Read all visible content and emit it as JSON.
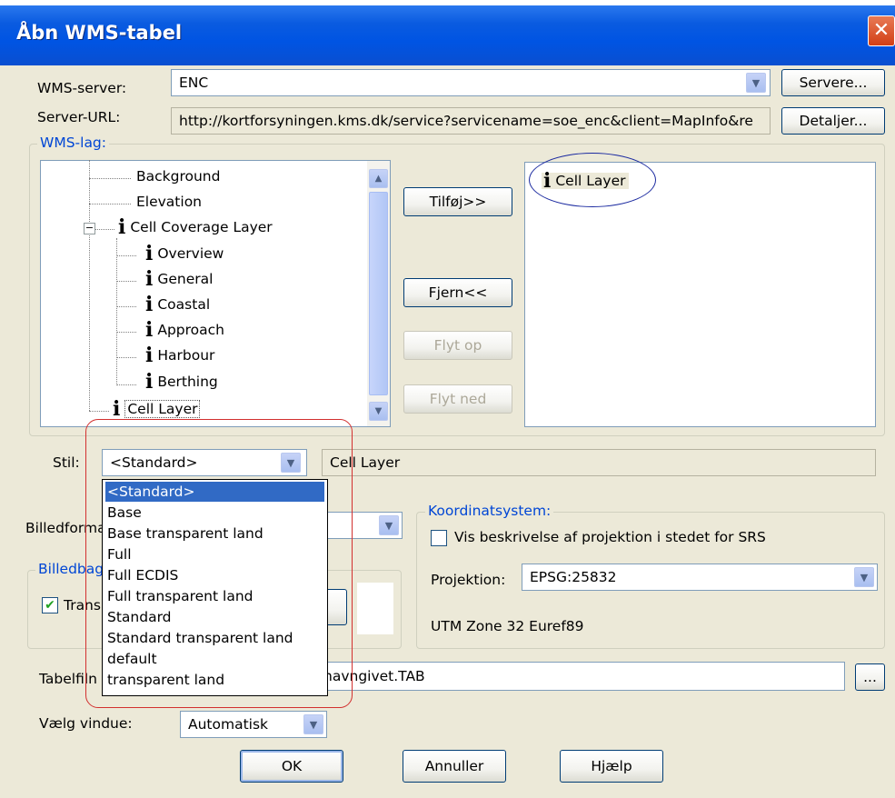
{
  "window": {
    "title": "Åbn WMS-tabel",
    "close_glyph": "✕"
  },
  "wms_server": {
    "label": "WMS-server:",
    "value": "ENC",
    "button": "Servere..."
  },
  "server_url": {
    "label": "Server-URL:",
    "value": "http://kortforsyningen.kms.dk/service?servicename=soe_enc&client=MapInfo&re",
    "button": "Detaljer..."
  },
  "wms_lag": {
    "label": "WMS-lag:",
    "tree": [
      "Background",
      "Elevation",
      "Cell Coverage Layer",
      "Overview",
      "General",
      "Coastal",
      "Approach",
      "Harbour",
      "Berthing",
      "Cell Layer"
    ],
    "expander_glyph": "−",
    "info_glyph": "i",
    "selected_list": [
      "Cell Layer"
    ]
  },
  "buttons": {
    "add": "Tilføj>>",
    "remove": "Fjern<<",
    "move_up": "Flyt op",
    "move_down": "Flyt ned"
  },
  "stil": {
    "label": "Stil:",
    "value": "<Standard>",
    "layer_name": "Cell Layer",
    "options": [
      "<Standard>",
      "Base",
      "Base transparent land",
      "Full",
      "Full ECDIS",
      "Full transparent land",
      "Standard",
      "Standard transparent land",
      "default",
      "transparent land"
    ]
  },
  "billedformat": {
    "label": "Billedforma"
  },
  "billedbag": {
    "label": "Billedbag",
    "transparent_label": "Trans",
    "checked_glyph": "✔"
  },
  "koordinatsystem": {
    "label": "Koordinatsystem:",
    "vis_beskrivelse": "Vis beskrivelse af projektion i stedet for SRS",
    "projektion_label": "Projektion:",
    "projektion_value": "EPSG:25832",
    "zone": "UTM Zone 32 Euref89"
  },
  "tabelfil": {
    "label": "Tabelfiln",
    "value_tail": "navngivet.TAB",
    "browse": "..."
  },
  "vaelg_vindue": {
    "label": "Vælg vindue:",
    "value": "Automatisk"
  },
  "footer": {
    "ok": "OK",
    "cancel": "Annuller",
    "help": "Hjælp"
  },
  "icons": {
    "combo_arrow": "▼",
    "scroll_up": "▲",
    "scroll_down": "▼"
  },
  "colors": {
    "title_bar": "#0054e3",
    "selection": "#316ac5",
    "annotation_red": "#d2302f",
    "annotation_blue": "#1b2aa0"
  }
}
